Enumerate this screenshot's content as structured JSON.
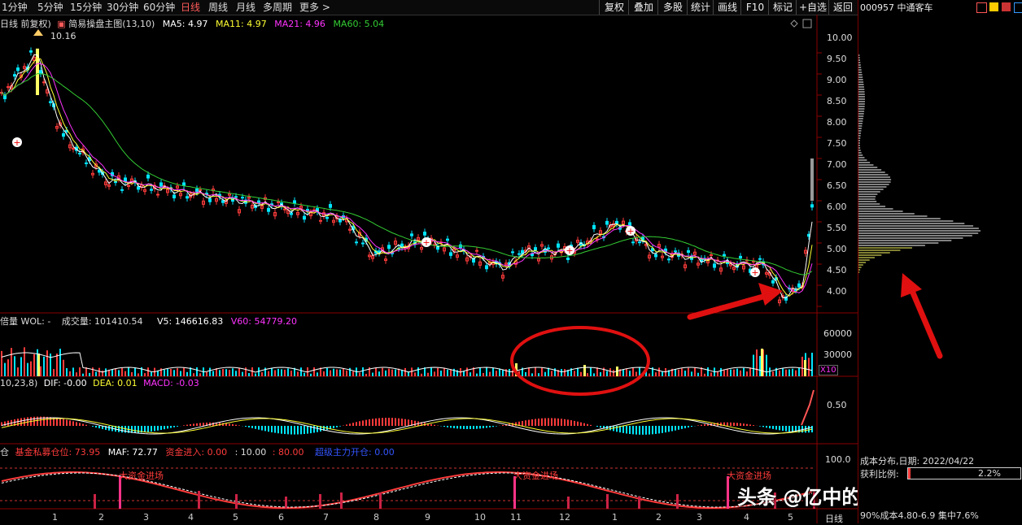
{
  "toolbar": {
    "periods": [
      "1分钟",
      "5分钟",
      "15分钟",
      "30分钟",
      "60分钟",
      "日线",
      "周线",
      "月线",
      "多周期",
      "更多 >"
    ],
    "active_period": "日线",
    "buttons": [
      "复权",
      "叠加",
      "多股",
      "统计",
      "画线",
      "F10",
      "标记",
      "+自选",
      "返回"
    ]
  },
  "stock": {
    "code_name": "000957 中通客车"
  },
  "main_chart": {
    "legend_prefix": "日线 前复权)",
    "indicator_name": "简易操盘主图(13,10)",
    "ma5": "MA5: 4.97",
    "ma11": "MA11: 4.97",
    "ma21": "MA21: 4.96",
    "ma60": "MA60: 5.04",
    "peak_label": "10.16",
    "y_ticks": [
      "10.00",
      "9.50",
      "9.00",
      "8.50",
      "8.00",
      "7.50",
      "7.00",
      "6.50",
      "6.00",
      "5.50",
      "5.00",
      "4.50",
      "4.00"
    ]
  },
  "volume_chart": {
    "legend_prefix": "倍量 WOL: -",
    "volume": "成交量: 101410.54",
    "v5": "V5: 146616.83",
    "v60": "V60: 54779.20",
    "y_ticks": [
      "60000",
      "30000"
    ],
    "scale": "X10"
  },
  "macd_chart": {
    "legend_prefix": "10,23,8)",
    "dif": "DIF: -0.00",
    "dea": "DEA: 0.01",
    "macd": "MACD: -0.03",
    "y_ticks": [
      "0.50"
    ]
  },
  "fund_chart": {
    "legend_prefix": "仓",
    "position": "基金私募仓位: 73.95",
    "maf": "MAF: 72.77",
    "inflow": "资金进入: 0.00",
    "level_10": ": 10.00",
    "level_80": ": 80.00",
    "super": "超级主力开仓: 0.00",
    "y_ticks": [
      "100.0"
    ],
    "annotations": [
      "大资金进场",
      "大资金进场",
      "大资金进场"
    ]
  },
  "x_axis": {
    "labels": [
      "1",
      "2",
      "3",
      "4",
      "5",
      "6",
      "7",
      "8",
      "9",
      "10",
      "11",
      "12",
      "1",
      "2",
      "3",
      "4",
      "5"
    ],
    "period_label": "日线"
  },
  "cost_panel": {
    "date_line": "成本分布,日期: 2022/04/22",
    "profit_label": "获利比例:",
    "profit_value": "2.2%",
    "cost_line": "90%成本4.80-6.9 集中7.6%"
  },
  "watermark": "头条 @亿中的炒股笔记",
  "colors": {
    "up": "#ff3b3b",
    "down": "#00e5ff",
    "ma5": "#ffffff",
    "ma11": "#ffff33",
    "ma21": "#ff33ff",
    "ma60": "#33cc33",
    "annotation": "#ff2020"
  }
}
